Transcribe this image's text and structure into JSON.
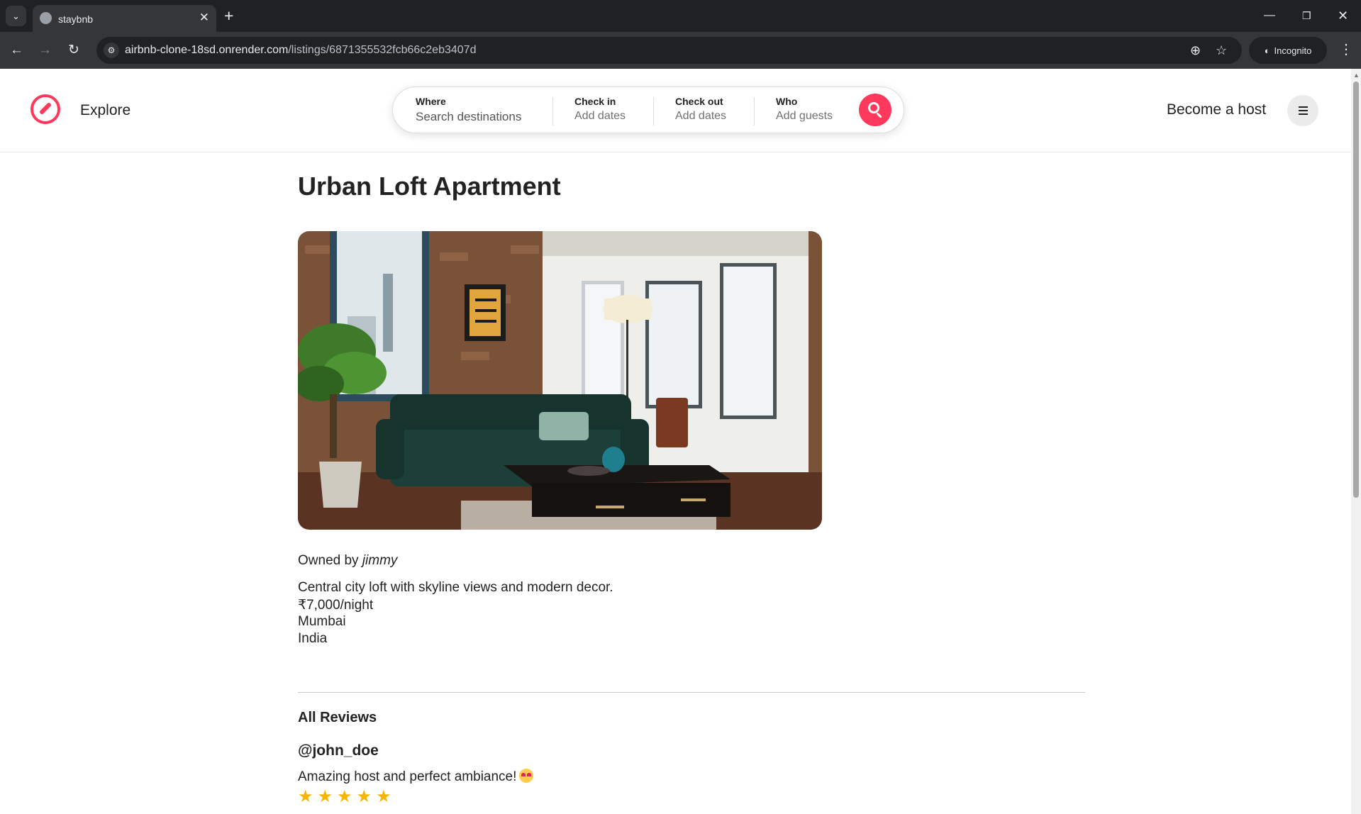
{
  "browser": {
    "tab_title": "staybnb",
    "url_host": "airbnb-clone-18sd.onrender.com",
    "url_path": "/listings/6871355532fcb66c2eb3407d",
    "incognito_label": "Incognito"
  },
  "nav": {
    "explore_label": "Explore",
    "become_host_label": "Become a host"
  },
  "search": {
    "where_label": "Where",
    "where_placeholder": "Search destinations",
    "checkin_label": "Check in",
    "checkin_value": "Add dates",
    "checkout_label": "Check out",
    "checkout_value": "Add dates",
    "who_label": "Who",
    "who_value": "Add guests"
  },
  "listing": {
    "title": "Urban Loft Apartment",
    "owner_prefix": "Owned by",
    "owner_name": "jimmy",
    "description": "Central city loft with skyline views and modern decor.",
    "price": "₹7,000/night",
    "city": "Mumbai",
    "country": "India"
  },
  "reviews": {
    "heading": "All Reviews",
    "items": [
      {
        "author": "@john_doe",
        "comment": "Amazing host and perfect ambiance!",
        "rating": 5
      }
    ]
  },
  "colors": {
    "brand": "#ff385c",
    "star": "#f7b500"
  }
}
